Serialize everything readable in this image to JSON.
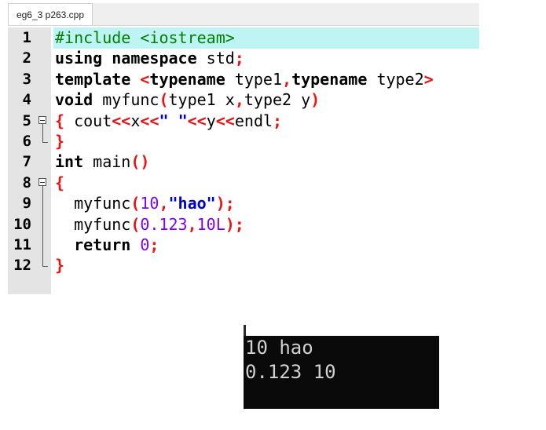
{
  "tab": {
    "title": "eg6_3 p263.cpp"
  },
  "editor": {
    "lines": [
      {
        "num": "1",
        "tokens": [
          [
            "pp",
            "#include <iostream>"
          ]
        ]
      },
      {
        "num": "2",
        "tokens": [
          [
            "kw",
            "using namespace "
          ],
          [
            "id",
            "std"
          ],
          [
            "op",
            ";"
          ]
        ]
      },
      {
        "num": "3",
        "tokens": [
          [
            "kw",
            "template "
          ],
          [
            "op",
            "<"
          ],
          [
            "kw",
            "typename "
          ],
          [
            "id",
            "type1"
          ],
          [
            "op",
            ","
          ],
          [
            "kw",
            "typename "
          ],
          [
            "id",
            "type2"
          ],
          [
            "op",
            ">"
          ]
        ]
      },
      {
        "num": "4",
        "tokens": [
          [
            "kw",
            "void "
          ],
          [
            "id",
            "myfunc"
          ],
          [
            "op",
            "("
          ],
          [
            "id",
            "type1 x"
          ],
          [
            "op",
            ","
          ],
          [
            "id",
            "type2 y"
          ],
          [
            "op",
            ")"
          ]
        ]
      },
      {
        "num": "5",
        "tokens": [
          [
            "op",
            "{"
          ],
          [
            "id",
            " cout"
          ],
          [
            "op",
            "<<"
          ],
          [
            "id",
            "x"
          ],
          [
            "op",
            "<<"
          ],
          [
            "str",
            "\" \""
          ],
          [
            "op",
            "<<"
          ],
          [
            "id",
            "y"
          ],
          [
            "op",
            "<<"
          ],
          [
            "id",
            "endl"
          ],
          [
            "op",
            ";"
          ]
        ]
      },
      {
        "num": "6",
        "tokens": [
          [
            "op",
            "}"
          ]
        ]
      },
      {
        "num": "7",
        "tokens": [
          [
            "kw",
            "int "
          ],
          [
            "id",
            "main"
          ],
          [
            "op",
            "()"
          ]
        ]
      },
      {
        "num": "8",
        "tokens": [
          [
            "op",
            "{"
          ]
        ]
      },
      {
        "num": "9",
        "tokens": [
          [
            "id",
            "  myfunc"
          ],
          [
            "op",
            "("
          ],
          [
            "num",
            "10"
          ],
          [
            "op",
            ","
          ],
          [
            "str",
            "\"hao\""
          ],
          [
            "op",
            ");"
          ]
        ]
      },
      {
        "num": "10",
        "tokens": [
          [
            "id",
            "  myfunc"
          ],
          [
            "op",
            "("
          ],
          [
            "num",
            "0.123"
          ],
          [
            "op",
            ","
          ],
          [
            "num",
            "10L"
          ],
          [
            "op",
            ");"
          ]
        ]
      },
      {
        "num": "11",
        "tokens": [
          [
            "kw",
            "  return "
          ],
          [
            "num",
            "0"
          ],
          [
            "op",
            ";"
          ]
        ]
      },
      {
        "num": "12",
        "tokens": [
          [
            "op",
            "}"
          ]
        ]
      }
    ],
    "highlight_line": 0
  },
  "console": {
    "lines": [
      "10 hao",
      "0.123 10"
    ]
  }
}
